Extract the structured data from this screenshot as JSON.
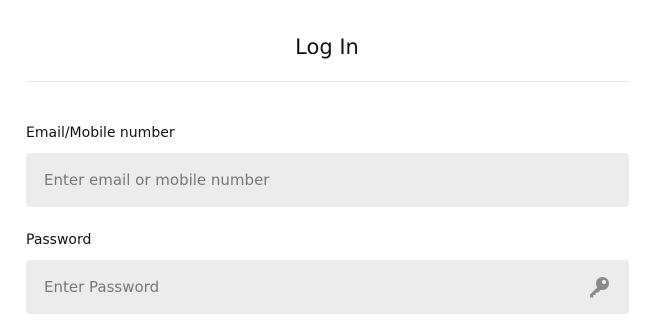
{
  "header": {
    "title": "Log In"
  },
  "form": {
    "email": {
      "label": "Email/Mobile number",
      "value": "",
      "placeholder": "Enter email or mobile number"
    },
    "password": {
      "label": "Password",
      "value": "",
      "placeholder": "Enter Password",
      "icon": "key-icon"
    }
  },
  "colors": {
    "field_background": "#ececec",
    "icon": "#8a8a8a",
    "divider": "#e6e6e6"
  }
}
